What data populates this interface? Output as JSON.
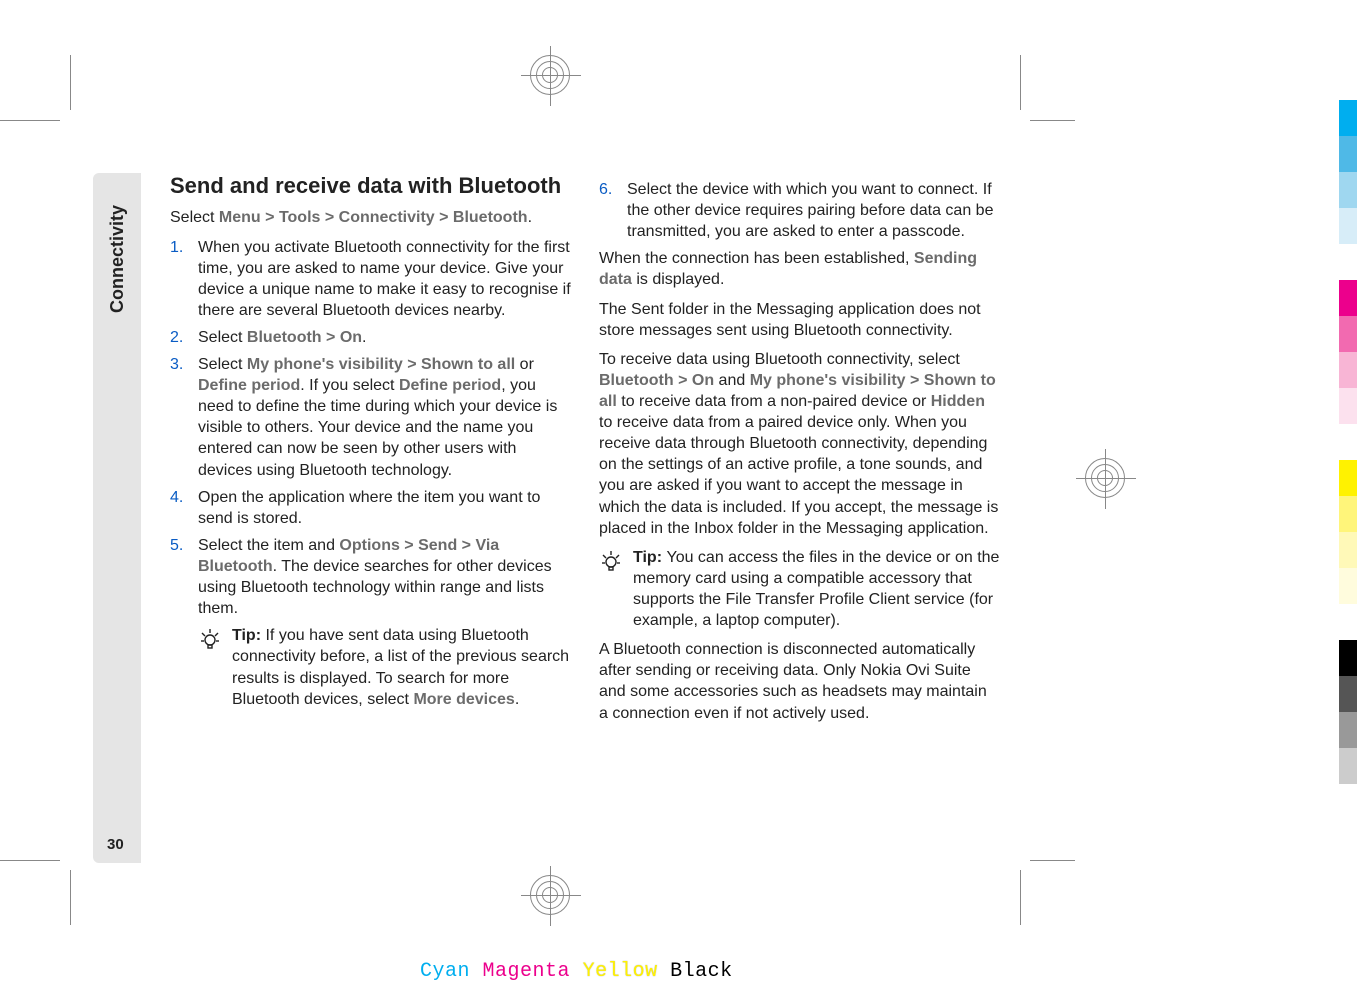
{
  "sidebar": {
    "section_label": "Connectivity",
    "page_number": "30"
  },
  "heading": "Send and receive data with Bluetooth",
  "select_path": {
    "prefix": "Select ",
    "menu": "Menu",
    "sep": " > ",
    "tools": "Tools",
    "connectivity": "Connectivity",
    "bluetooth": "Bluetooth",
    "period": "."
  },
  "steps": {
    "1": "When you activate Bluetooth connectivity for the first time, you are asked to name your device. Give your device a unique name to make it easy to recognise if there are several Bluetooth devices nearby.",
    "2_prefix": "Select ",
    "2_bluetooth": "Bluetooth",
    "2_sep": " > ",
    "2_on": "On",
    "2_period": ".",
    "3_prefix": "Select ",
    "3_vis": "My phone's visibility",
    "3_sep": " > ",
    "3_shown": "Shown to all",
    "3_or": " or ",
    "3_define": "Define period",
    "3_mid1": ". If you select ",
    "3_define2": "Define period",
    "3_rest": ", you need to define the time during which your device is visible to others. Your device and the name you entered can now be seen by other users with devices using Bluetooth technology.",
    "4": "Open the application where the item you want to send is stored.",
    "5_prefix": "Select the item and ",
    "5_options": "Options",
    "5_sep": " > ",
    "5_send": "Send",
    "5_via": "Via Bluetooth",
    "5_rest": ". The device searches for other devices using Bluetooth technology within range and lists them.",
    "6": "Select the device with which you want to connect. If the other device requires pairing before data can be transmitted, you are asked to enter a passcode."
  },
  "tip1": {
    "label": "Tip: ",
    "body_pre": "If you have sent data using Bluetooth connectivity before, a list of the previous search results is displayed. To search for more Bluetooth devices, select ",
    "more_devices": "More devices",
    "period": "."
  },
  "col2": {
    "established_pre": "When the connection has been established, ",
    "sending_data": "Sending data",
    "established_post": " is displayed.",
    "sent_folder": "The Sent folder in the Messaging application does not store messages sent using Bluetooth connectivity.",
    "receive_pre": "To receive data using Bluetooth connectivity, select ",
    "bluetooth": "Bluetooth",
    "sep": " > ",
    "on": "On",
    "and": " and ",
    "vis": "My phone's visibility",
    "shown": "Shown to all",
    "receive_mid": " to receive data from a non-paired device or ",
    "hidden": "Hidden",
    "receive_post": " to receive data from a paired device only. When you receive data through Bluetooth connectivity, depending on the settings of an active profile, a tone sounds, and you are asked if you want to accept the message in which the data is included. If you accept, the message is placed in the Inbox folder in the Messaging application.",
    "tip2_label": "Tip: ",
    "tip2_body": "You can access the files in the device or on the memory card using a compatible accessory that supports the File Transfer Profile Client service (for example, a laptop computer).",
    "disconnect": "A Bluetooth connection is disconnected automatically after sending or receiving data. Only Nokia Ovi Suite and some accessories such as headsets may maintain a connection even if not actively used."
  },
  "footer": {
    "cyan": "Cyan",
    "magenta": "Magenta",
    "yellow": "Yellow",
    "black": "Black"
  },
  "color_bars": [
    "#00aeef",
    "#4fb9e7",
    "#9fd7f0",
    "#d7edf8",
    "#ffffff",
    "#ec008c",
    "#f26ab0",
    "#f8b5d5",
    "#fce1ee",
    "#ffffff",
    "#fff200",
    "#fff57a",
    "#fff9b8",
    "#fffcdd",
    "#ffffff",
    "#000000",
    "#555555",
    "#999999",
    "#cccccc",
    "#ffffff"
  ]
}
